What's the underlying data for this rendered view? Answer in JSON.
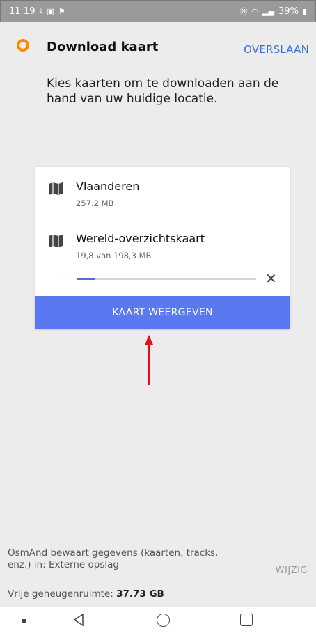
{
  "status_bar": {
    "time": "11:19",
    "notification_icons": [
      "download-icon",
      "image-icon",
      "flag-icon"
    ],
    "right_icons": [
      "nfc-icon",
      "wifi-icon",
      "signal-icon"
    ],
    "battery": "39%"
  },
  "header": {
    "title": "Download kaart",
    "skip_label": "OVERSLAAN",
    "subtitle": "Kies kaarten om te downloaden aan de hand van uw huidige locatie."
  },
  "maps": [
    {
      "name": "Vlaanderen",
      "size": "257.2 MB",
      "icon": "map-icon"
    },
    {
      "name": "Wereld-overzichtskaart",
      "size": "19,8 van 198,3 MB",
      "icon": "map-icon",
      "progress": 0.1
    }
  ],
  "show_map_button": "KAART WEERGEVEN",
  "annotation": {
    "color": "#e0101a"
  },
  "storage": {
    "info": "OsmAnd bewaart gegevens (kaarten, tracks, enz.) in: Externe opslag",
    "change_label": "WIJZIG",
    "free_label": "Vrije geheugenruimte: ",
    "free_value": "37.73 GB"
  },
  "colors": {
    "accent": "#5a78f0",
    "logo": "#ff8a00",
    "link": "#3a6fd8"
  }
}
